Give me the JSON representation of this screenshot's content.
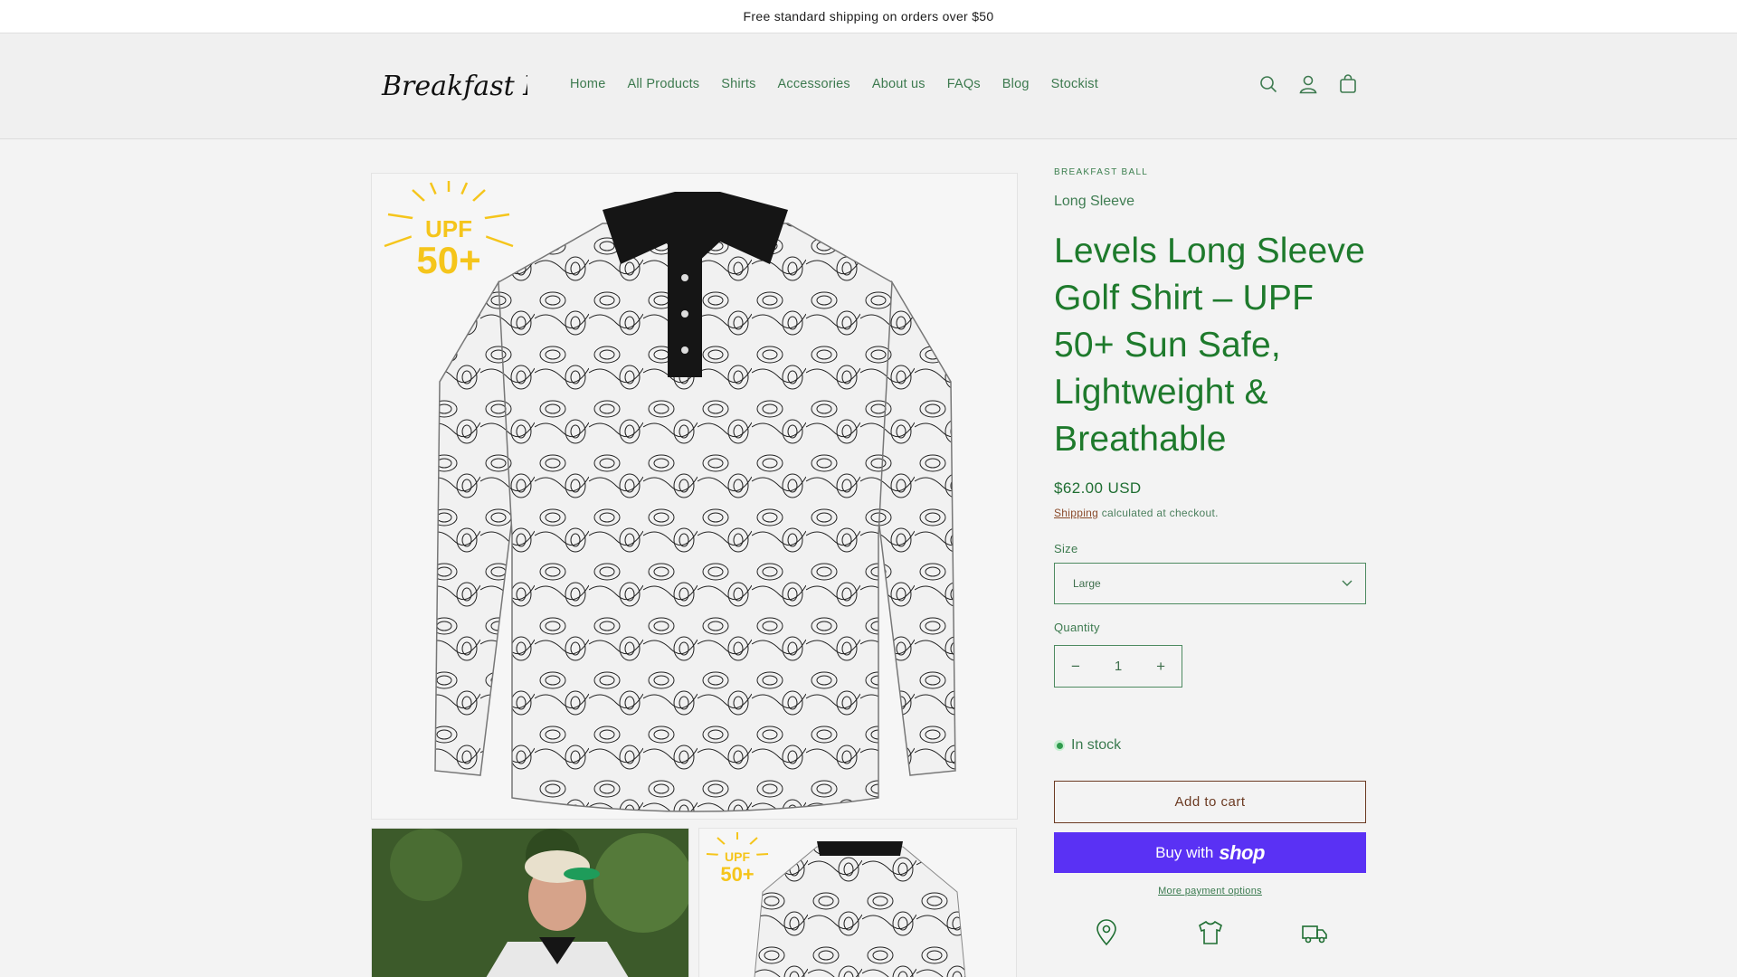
{
  "announcement": "Free standard shipping on orders over $50",
  "header": {
    "logo_text": "Breakfast Ball",
    "nav": [
      "Home",
      "All Products",
      "Shirts",
      "Accessories",
      "About us",
      "FAQs",
      "Blog",
      "Stockist"
    ],
    "icons": [
      "search-icon",
      "account-icon",
      "cart-icon"
    ]
  },
  "gallery": {
    "badge_top": "UPF",
    "badge_bottom": "50+",
    "badge_color": "#f5c51b"
  },
  "product": {
    "vendor": "BREAKFAST BALL",
    "subtitle": "Long Sleeve",
    "title": "Levels Long Sleeve Golf Shirt – UPF 50+ Sun Safe, Lightweight & Breathable",
    "price": "$62.00 USD",
    "shipping_link": "Shipping",
    "shipping_rest": " calculated at checkout.",
    "size_label": "Size",
    "size_value": "Large",
    "quantity_label": "Quantity",
    "quantity_value": "1",
    "decrement": "−",
    "increment": "+",
    "stock": "In stock",
    "add_to_cart": "Add to cart",
    "buy_prefix": "Buy with",
    "buy_brand": "shop",
    "more_payment": "More payment options",
    "feature_icons": [
      "location-pin-icon",
      "tshirt-icon",
      "delivery-truck-icon"
    ]
  },
  "colors": {
    "accent_green": "#1e7a2c",
    "nav_green": "#3d7a4f",
    "shop_pay": "#5a31f4",
    "cart_border": "#6b3a22"
  }
}
